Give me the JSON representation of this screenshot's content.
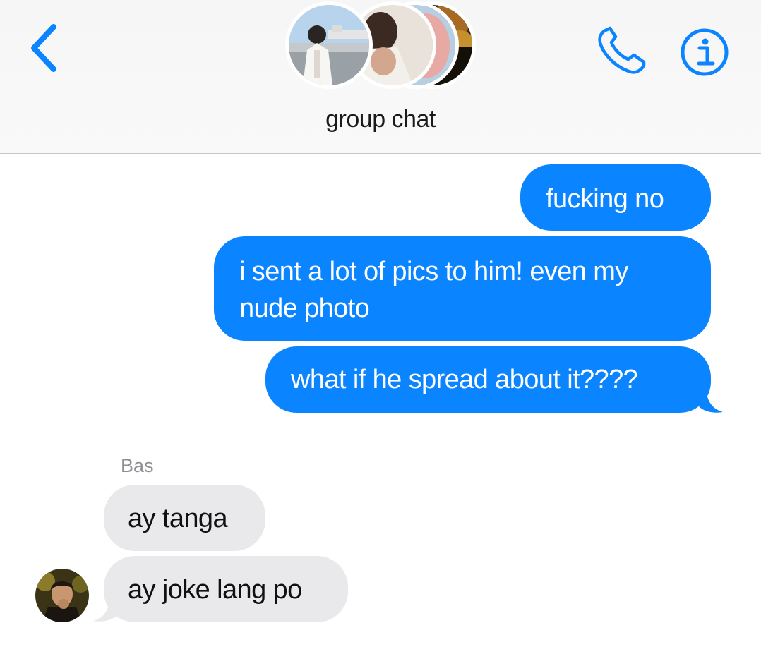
{
  "header": {
    "title": "group chat",
    "back_icon": "chevron-left-icon",
    "call_icon": "phone-icon",
    "info_icon": "info-icon"
  },
  "colors": {
    "accent": "#0a84ff",
    "outgoing_bubble": "#0a84ff",
    "incoming_bubble": "#e9e9eb",
    "sender_name": "#8e8e93"
  },
  "messages": [
    {
      "direction": "outgoing",
      "text": "fucking no"
    },
    {
      "direction": "outgoing",
      "text": "i sent a lot of pics to him! even my nude photo"
    },
    {
      "direction": "outgoing",
      "text": "what if he spread about it????"
    },
    {
      "direction": "incoming",
      "sender": "Bas",
      "text": "ay tanga"
    },
    {
      "direction": "incoming",
      "text": "ay joke lang po"
    }
  ]
}
